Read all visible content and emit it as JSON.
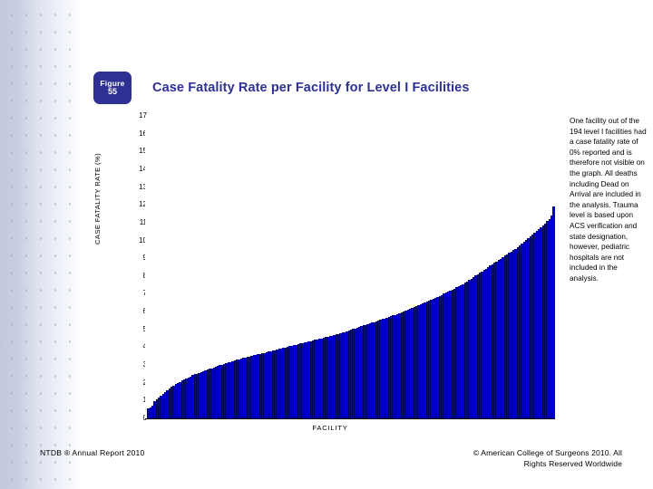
{
  "slide": {
    "figure": {
      "label": "Figure",
      "number": "55"
    },
    "title": "Case Fatality Rate per Facility for Level I Facilities",
    "note": "One facility out of the 194 level I facilities had a case fatality rate of 0% reported and is therefore not visible on the graph. All deaths including Dead on Arrival are included in the analysis. Trauma level is based upon ACS verification and state designation, however, pediatric hospitals are not included in the analysis.",
    "footer_left": "NTDB ® Annual Report 2010",
    "footer_right_line1": "© American College of Surgeons 2010.  All",
    "footer_right_line2": "Rights Reserved Worldwide",
    "colors": {
      "accent": "#2e3192",
      "bar": "#0000cc",
      "bar_edge": "#00005f"
    }
  },
  "chart_data": {
    "type": "bar",
    "title": "Case Fatality Rate per Facility for Level I Facilities",
    "xlabel": "FACILITY",
    "ylabel": "CASE FATALITY RATE (%)",
    "ylim": [
      0,
      17
    ],
    "grid": false,
    "legend": null,
    "yticks": [
      17,
      16,
      15,
      14,
      13,
      12,
      11,
      10,
      9,
      8,
      7,
      6,
      5,
      4,
      3,
      2,
      1,
      0
    ],
    "ytick_labels": [
      "17",
      "16",
      "15",
      "14",
      "13",
      "12",
      "11",
      "10",
      "9",
      "8",
      "7",
      "6",
      "5",
      "4",
      "3",
      "2",
      "1",
      "0"
    ],
    "n_facilities": 194,
    "categories_note": "Facilities sorted ascending by case fatality rate; individual facility labels are not shown",
    "values": [
      0.0,
      0.55,
      0.62,
      0.7,
      0.95,
      1.05,
      1.15,
      1.25,
      1.4,
      1.5,
      1.6,
      1.7,
      1.78,
      1.85,
      1.92,
      2.0,
      2.05,
      2.12,
      2.18,
      2.24,
      2.3,
      2.36,
      2.42,
      2.47,
      2.52,
      2.57,
      2.62,
      2.66,
      2.7,
      2.74,
      2.78,
      2.82,
      2.86,
      2.9,
      2.94,
      2.98,
      3.02,
      3.06,
      3.1,
      3.14,
      3.18,
      3.22,
      3.26,
      3.3,
      3.33,
      3.36,
      3.39,
      3.42,
      3.45,
      3.48,
      3.51,
      3.54,
      3.57,
      3.6,
      3.63,
      3.66,
      3.69,
      3.72,
      3.75,
      3.78,
      3.81,
      3.84,
      3.87,
      3.9,
      3.93,
      3.96,
      3.99,
      4.02,
      4.05,
      4.08,
      4.11,
      4.14,
      4.17,
      4.2,
      4.23,
      4.26,
      4.29,
      4.32,
      4.35,
      4.38,
      4.41,
      4.44,
      4.47,
      4.5,
      4.53,
      4.56,
      4.59,
      4.62,
      4.65,
      4.68,
      4.71,
      4.74,
      4.78,
      4.82,
      4.86,
      4.9,
      4.94,
      4.98,
      5.02,
      5.06,
      5.1,
      5.14,
      5.18,
      5.22,
      5.26,
      5.3,
      5.34,
      5.38,
      5.42,
      5.46,
      5.5,
      5.54,
      5.58,
      5.62,
      5.66,
      5.7,
      5.74,
      5.78,
      5.82,
      5.86,
      5.9,
      5.95,
      6.0,
      6.05,
      6.1,
      6.15,
      6.2,
      6.25,
      6.3,
      6.35,
      6.4,
      6.45,
      6.5,
      6.55,
      6.6,
      6.65,
      6.7,
      6.76,
      6.82,
      6.88,
      6.94,
      7.0,
      7.06,
      7.12,
      7.18,
      7.24,
      7.3,
      7.36,
      7.42,
      7.48,
      7.54,
      7.62,
      7.7,
      7.78,
      7.86,
      7.94,
      8.02,
      8.1,
      8.18,
      8.26,
      8.34,
      8.42,
      8.5,
      8.58,
      8.66,
      8.74,
      8.82,
      8.9,
      8.98,
      9.06,
      9.14,
      9.22,
      9.3,
      9.38,
      9.46,
      9.54,
      9.62,
      9.72,
      9.82,
      9.92,
      10.02,
      10.12,
      10.22,
      10.32,
      10.42,
      10.52,
      10.62,
      10.72,
      10.84,
      10.96,
      11.08,
      11.2,
      11.4,
      11.9
    ]
  }
}
